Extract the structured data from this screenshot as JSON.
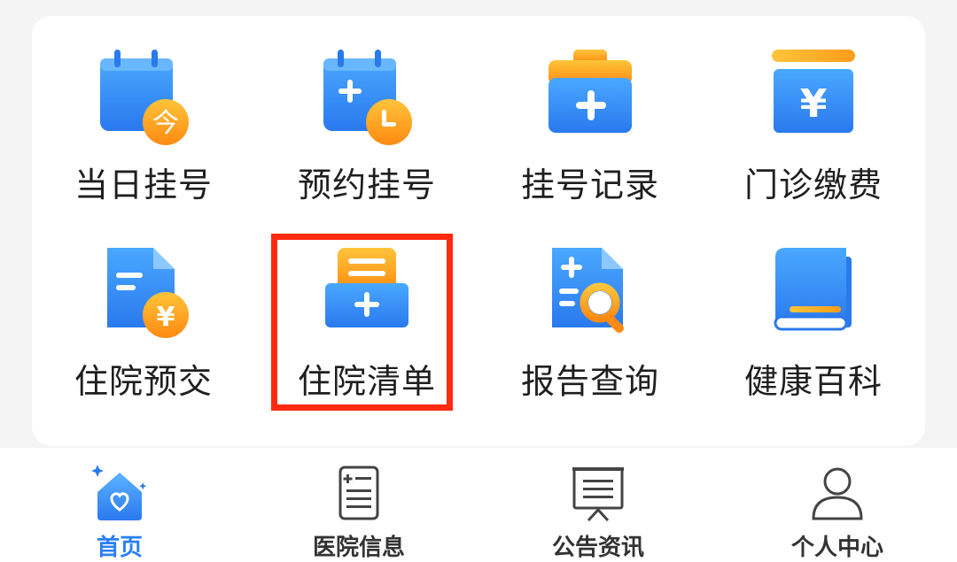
{
  "menu": {
    "items": [
      {
        "id": "same-day",
        "label": "当日挂号",
        "icon": "calendar-today-icon",
        "badge": "今"
      },
      {
        "id": "appointment",
        "label": "预约挂号",
        "icon": "calendar-clock-icon"
      },
      {
        "id": "records",
        "label": "挂号记录",
        "icon": "medical-folder-icon"
      },
      {
        "id": "payment",
        "label": "门诊缴费",
        "icon": "yen-box-icon",
        "symbol": "¥"
      },
      {
        "id": "prepay",
        "label": "住院预交",
        "icon": "document-yen-icon",
        "symbol": "¥"
      },
      {
        "id": "inpatient-list",
        "label": "住院清单",
        "icon": "inpatient-list-icon"
      },
      {
        "id": "reports",
        "label": "报告查询",
        "icon": "report-search-icon"
      },
      {
        "id": "encyclopedia",
        "label": "健康百科",
        "icon": "book-icon"
      }
    ]
  },
  "tabbar": {
    "tabs": [
      {
        "label": "首页",
        "icon": "home-heart-icon",
        "active": true
      },
      {
        "label": "医院信息",
        "icon": "hospital-info-icon",
        "active": false
      },
      {
        "label": "公告资讯",
        "icon": "notice-board-icon",
        "active": false
      },
      {
        "label": "个人中心",
        "icon": "user-icon",
        "active": false
      }
    ]
  },
  "colors": {
    "blue": "#2f8cf3",
    "blue_light": "#4aa8ff",
    "orange": "#ff9c1a",
    "orange_light": "#ffc43a",
    "highlight": "#ff2a10",
    "tab_active": "#2a7ff5"
  }
}
